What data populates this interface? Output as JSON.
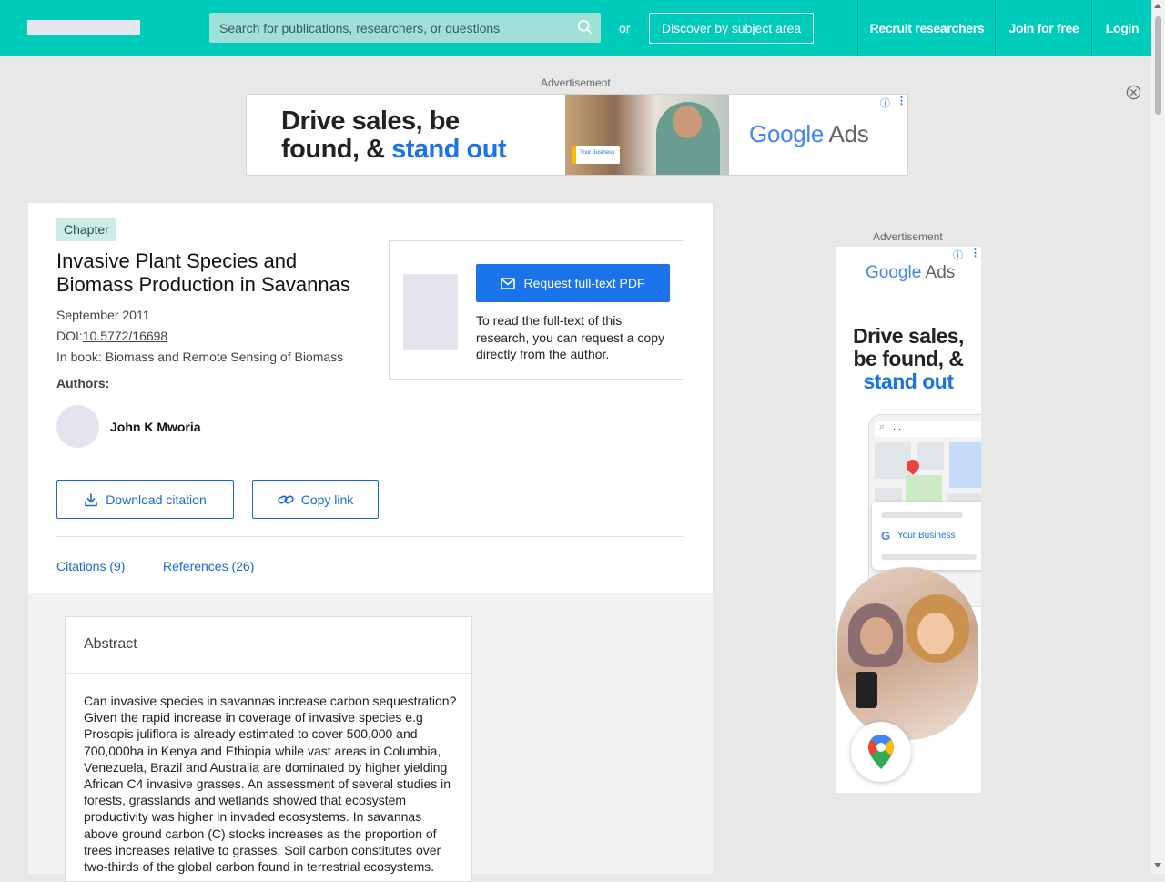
{
  "header": {
    "search_placeholder": "Search for publications, researchers, or questions",
    "or_label": "or",
    "discover_label": "Discover by subject area",
    "nav": [
      "Recruit researchers",
      "Join for free",
      "Login"
    ],
    "brand_color": "#00ccbb"
  },
  "ads": {
    "label": "Advertisement",
    "banner": {
      "headline_line1": "Drive sales, be",
      "headline_line2a": "found, & ",
      "headline_line2b": "stand out",
      "logo_google": "Google",
      "logo_ads": "Ads",
      "mini_tag": "Your Business"
    },
    "side": {
      "logo_google": "Google",
      "logo_ads": "Ads",
      "headline_line1": "Drive sales,",
      "headline_line2": "be found, &",
      "headline_line3": "stand out",
      "map_search": "...",
      "business_label": "Your Business"
    }
  },
  "publication": {
    "type": "Chapter",
    "title": "Invasive Plant Species and Biomass Production in Savannas",
    "date": "September 2011",
    "doi_label": "DOI:",
    "doi": "10.5772/16698",
    "book": "In book: Biomass and Remote Sensing of Biomass",
    "authors_label": "Authors:",
    "authors": [
      "John K Mworia"
    ],
    "download_citation": "Download citation",
    "copy_link": "Copy link",
    "tabs": [
      "Citations (9)",
      "References (26)"
    ],
    "request_pdf": "Request full-text PDF",
    "request_note": "To read the full-text of this research, you can request a copy directly from the author.",
    "accent_color": "#1a73e8"
  },
  "abstract": {
    "heading": "Abstract",
    "text": "Can invasive species in savannas increase carbon sequestration? Given the rapid increase in coverage of invasive species e.g Prosopis juliflora is already estimated to cover 500,000 and 700,000ha in Kenya and Ethiopia while vast areas in Columbia, Venezuela, Brazil and Australia are dominated by higher yielding African C4 invasive grasses. An assessment of several studies in forests, grasslands and wetlands showed that ecosystem productivity was higher in invaded ecosystems. In savannas above ground carbon (C) stocks increases as the proportion of trees increases relative to grasses. Soil carbon constitutes over two-thirds of the global carbon found in terrestrial ecosystems."
  }
}
